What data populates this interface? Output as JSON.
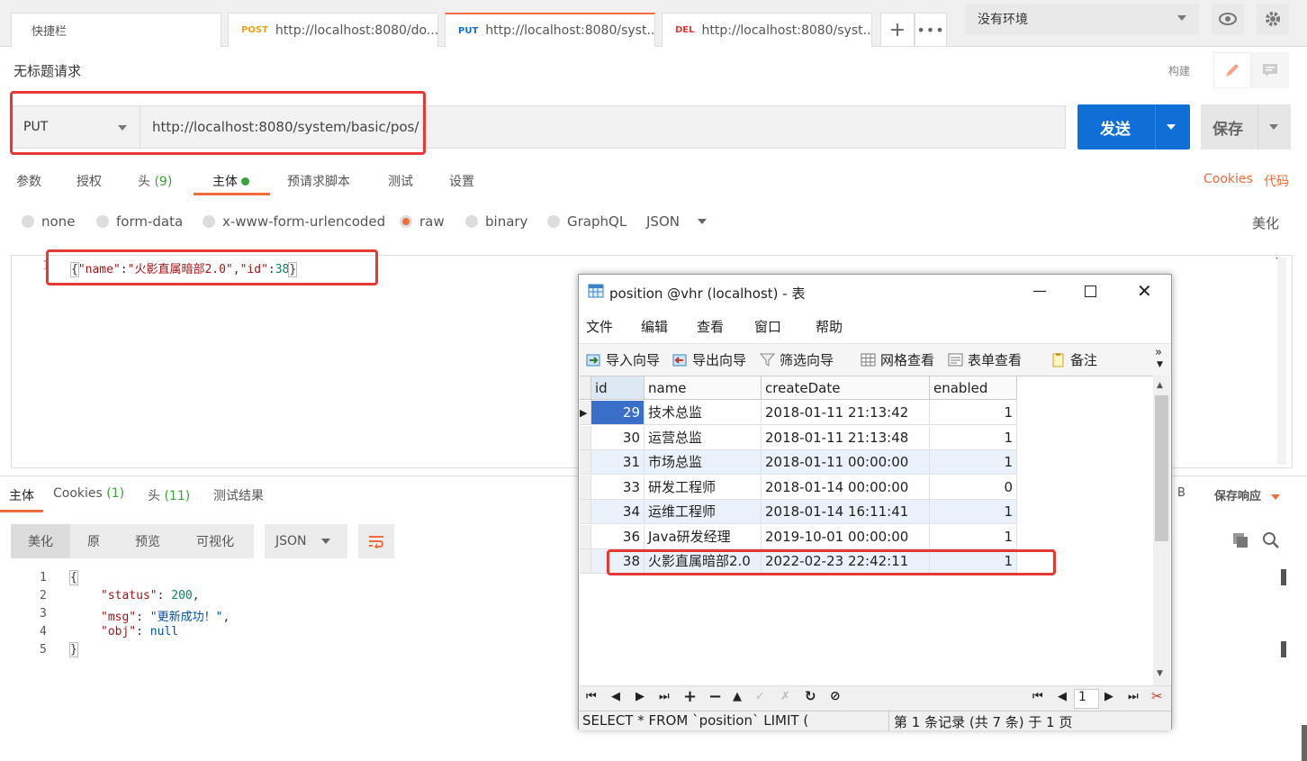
{
  "tabs": [
    {
      "label": "快捷栏"
    },
    {
      "method": "POST",
      "url": "http://localhost:8080/do..."
    },
    {
      "method": "PUT",
      "url": "http://localhost:8080/syst..."
    },
    {
      "method": "DEL",
      "url": "http://localhost:8080/syst..."
    }
  ],
  "env": {
    "label": "没有环境"
  },
  "request": {
    "title": "无标题请求",
    "build_label": "构建",
    "method": "PUT",
    "url": "http://localhost:8080/system/basic/pos/",
    "send_label": "发送",
    "save_label": "保存"
  },
  "request_tabs": {
    "params": "参数",
    "auth": "授权",
    "headers": "头",
    "headers_count": "(9)",
    "body": "主体",
    "prerequest": "预请求脚本",
    "tests": "测试",
    "settings": "设置",
    "cookies": "Cookies",
    "code": "代码"
  },
  "body_types": {
    "none": "none",
    "form_data": "form-data",
    "urlencoded": "x-www-form-urlencoded",
    "raw": "raw",
    "binary": "binary",
    "graphql": "GraphQL",
    "json": "JSON",
    "beautify": "美化"
  },
  "editor": {
    "line_number": "1",
    "brace_open": "{",
    "key1": "\"name\"",
    "colon1": ":",
    "val1": "\"火影直属暗部2.0\"",
    "comma": ",",
    "key2": "\"id\"",
    "colon2": ":",
    "val2": "38",
    "brace_close": "}"
  },
  "response_tabs": {
    "body": "主体",
    "cookies": "Cookies",
    "cookies_count": "(1)",
    "headers": "头",
    "headers_count": "(11)",
    "test_results": "测试结果",
    "size_fragment": "B",
    "save_response": "保存响应"
  },
  "response_toolbar": {
    "beautify": "美化",
    "raw": "原",
    "preview": "预览",
    "visualize": "可视化",
    "format": "JSON"
  },
  "response_body": [
    {
      "n": "1",
      "text": "{"
    },
    {
      "n": "2",
      "key": "\"status\"",
      "sep": ": ",
      "val": "200",
      "tail": ","
    },
    {
      "n": "3",
      "key": "\"msg\"",
      "sep": ": ",
      "val": "\"更新成功！\"",
      "tail": ","
    },
    {
      "n": "4",
      "key": "\"obj\"",
      "sep": ": ",
      "val": "null",
      "tail": ""
    },
    {
      "n": "5",
      "text": "}"
    }
  ],
  "db": {
    "title": "position @vhr (localhost) - 表",
    "menu": [
      "文件",
      "编辑",
      "查看",
      "窗口",
      "帮助"
    ],
    "toolbar": [
      "导入向导",
      "导出向导",
      "筛选向导",
      "网格查看",
      "表单查看",
      "备注"
    ],
    "columns": [
      "id",
      "name",
      "createDate",
      "enabled"
    ],
    "rows": [
      {
        "id": "29",
        "name": "技术总监",
        "createDate": "2018-01-11 21:13:42",
        "enabled": "1"
      },
      {
        "id": "30",
        "name": "运营总监",
        "createDate": "2018-01-11 21:13:48",
        "enabled": "1"
      },
      {
        "id": "31",
        "name": "市场总监",
        "createDate": "2018-01-11 00:00:00",
        "enabled": "1"
      },
      {
        "id": "33",
        "name": "研发工程师",
        "createDate": "2018-01-14 00:00:00",
        "enabled": "0"
      },
      {
        "id": "34",
        "name": "运维工程师",
        "createDate": "2018-01-14 16:11:41",
        "enabled": "1"
      },
      {
        "id": "36",
        "name": "Java研发经理",
        "createDate": "2019-10-01 00:00:00",
        "enabled": "1"
      },
      {
        "id": "38",
        "name": "火影直属暗部2.0",
        "createDate": "2022-02-23 22:42:11",
        "enabled": "1"
      }
    ],
    "page_input": "1",
    "sql": "SELECT * FROM `position` LIMIT (",
    "record_info": "第 1 条记录 (共 7 条) 于 1 页"
  },
  "colors": {
    "accent": "#f26b3a",
    "send": "#0f6fd6",
    "highlight": "#e53935",
    "success": "#37a33b"
  }
}
